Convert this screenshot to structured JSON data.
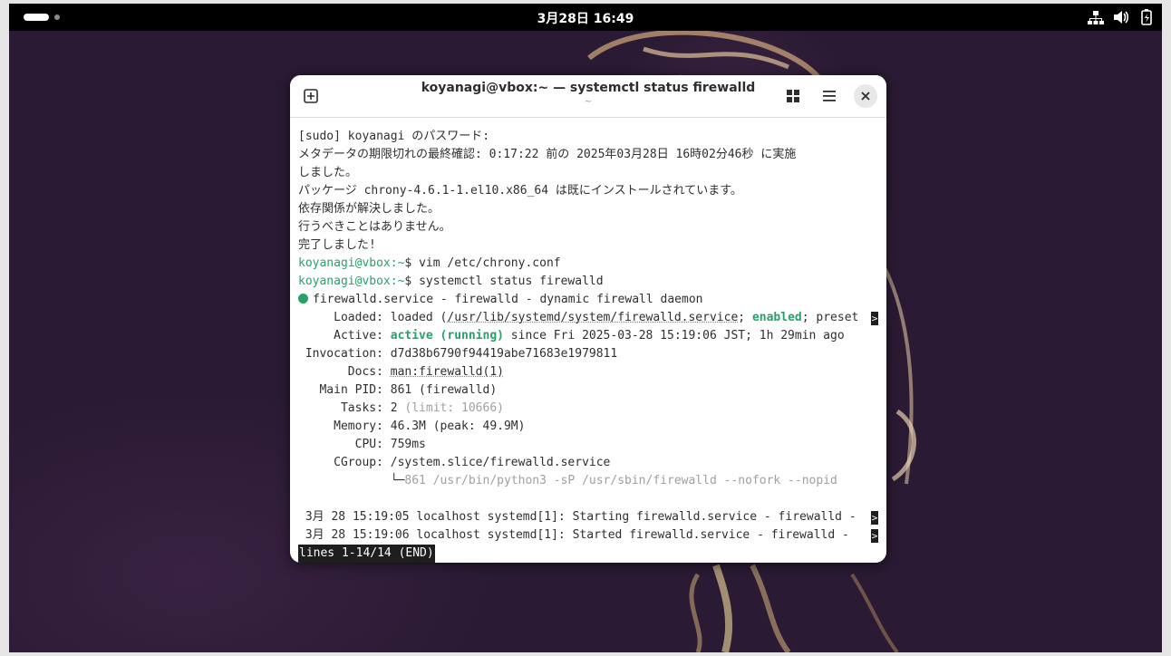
{
  "topbar": {
    "clock": "3月28日 16:49",
    "icons": [
      "network-icon",
      "volume-icon",
      "battery-icon"
    ]
  },
  "window": {
    "title": "koyanagi@vbox:~ — systemctl status firewalld",
    "subtitle": "~",
    "buttons": [
      "new-tab-icon",
      "tab-overview-icon",
      "menu-icon",
      "close-icon"
    ]
  },
  "terminal": {
    "lines": [
      "[sudo] koyanagi のパスワード:",
      "メタデータの期限切れの最終確認: 0:17:22 前の 2025年03月28日 16時02分46秒 に実施",
      "しました。",
      "パッケージ chrony-4.6.1-1.el10.x86_64 は既にインストールされています。",
      "依存関係が解決しました。",
      "行うべきことはありません。",
      "完了しました!"
    ],
    "prompt_user": "koyanagi@vbox",
    "prompt_path": ":~",
    "prompt_sign": "$ ",
    "cmd1": "vim /etc/chrony.conf",
    "cmd2": "systemctl status firewalld",
    "service_head": "firewalld.service - firewalld - dynamic firewall daemon",
    "loaded_label": "     Loaded: ",
    "loaded_a": "loaded (",
    "loaded_path": "/usr/lib/systemd/system/firewalld.service",
    "loaded_b": "; ",
    "loaded_enabled": "enabled",
    "loaded_c": "; preset",
    "active_label": "     Active: ",
    "active_state": "active (running)",
    "active_rest": " since Fri 2025-03-28 15:19:06 JST; 1h 29min ago",
    "invocation": " Invocation: d7d38b6790f94419abe71683e1979811",
    "docs_label": "       Docs: ",
    "docs_value": "man:firewalld(1)",
    "mainpid": "   Main PID: 861 (firewalld)",
    "tasks_a": "      Tasks: 2 ",
    "tasks_limit": "(limit: 10666)",
    "memory": "     Memory: 46.3M (peak: 49.9M)",
    "cpu": "        CPU: 759ms",
    "cgroup": "     CGroup: /system.slice/firewalld.service",
    "cgroup_child_branch": "             └─",
    "cgroup_child": "861 /usr/bin/python3 -sP /usr/sbin/firewalld --nofork --nopid",
    "log1": " 3月 28 15:19:05 localhost systemd[1]: Starting firewalld.service - firewalld -",
    "log2": " 3月 28 15:19:06 localhost systemd[1]: Started firewalld.service - firewalld - ",
    "truncate_mark": ">",
    "pager_status": "lines 1-14/14 (END)"
  },
  "colors": {
    "prompt": "#26a269",
    "terminal_bg": "#ffffff",
    "topbar": "#000000"
  }
}
